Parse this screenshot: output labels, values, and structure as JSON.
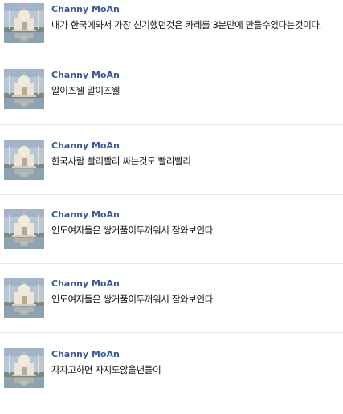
{
  "colors": {
    "author_name": "#3b5998",
    "message_text": "#111111",
    "divider": "#e4e6eb"
  },
  "avatar_icon": "taj-mahal-photo",
  "comments": [
    {
      "author": "Channy MoAn",
      "text": "내가 한국에와서 가장 신기했던것은 카레를 3분만에 만들수있다는것이다."
    },
    {
      "author": "Channy MoAn",
      "text": "알이즈웰 알이즈웰"
    },
    {
      "author": "Channy MoAn",
      "text": "한국사람 빨리빨리 싸는것도 빨리빨리"
    },
    {
      "author": "Channy MoAn",
      "text": "인도여자들은 쌍커풀이두꺼워서 잠와보인다"
    },
    {
      "author": "Channy MoAn",
      "text": "인도여자들은 쌍커풀이두꺼워서 잠와보인다"
    },
    {
      "author": "Channy MoAn",
      "text": "자자고하면 자지도않을년들이"
    }
  ]
}
